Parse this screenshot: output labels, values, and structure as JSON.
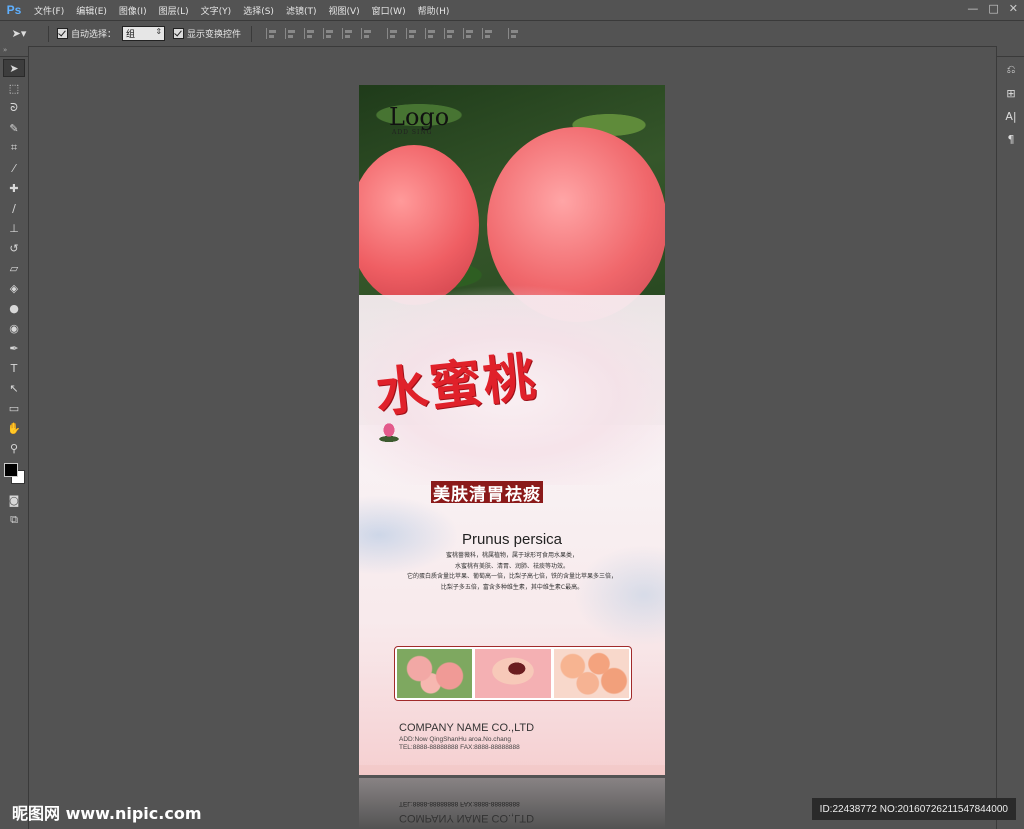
{
  "app": {
    "logo": "Ps"
  },
  "menu": [
    "文件(F)",
    "编辑(E)",
    "图像(I)",
    "图层(L)",
    "文字(Y)",
    "选择(S)",
    "滤镜(T)",
    "视图(V)",
    "窗口(W)",
    "帮助(H)"
  ],
  "window_controls": {
    "minimize": "—",
    "restore": "□",
    "close": "✕"
  },
  "options": {
    "auto_select_label": "自动选择：",
    "auto_select_value": "组",
    "show_transform_label": "显示变换控件"
  },
  "tools": [
    "move-tool",
    "marquee-tool",
    "lasso-tool",
    "quick-select-tool",
    "crop-tool",
    "eyedropper-tool",
    "healing-brush-tool",
    "brush-tool",
    "clone-stamp-tool",
    "history-brush-tool",
    "eraser-tool",
    "paint-bucket-tool",
    "blur-tool",
    "dodge-tool",
    "pen-tool",
    "type-tool",
    "path-select-tool",
    "shape-tool",
    "hand-tool",
    "zoom-tool"
  ],
  "poster": {
    "logo": "Logo",
    "logo_sub": "ADD SING",
    "title_cn": "水蜜桃",
    "slogan": "美肤清胃祛痰",
    "latin": "Prunus persica",
    "description": [
      "蜜桃蔷薇科，桃属植物，属于球形可食用水果类，",
      "水蜜桃有美肤、清胃、润肺、祛痰等功效。",
      "它的蛋白质含量比苹果、葡萄高一倍，比梨子高七倍，铁的含量比苹果多三倍，",
      "比梨子多五倍，富含多种维生素，其中维生素C最高。"
    ],
    "company": "COMPANY NAME CO.,LTD",
    "address": "ADD:Now QingShanHu aroa.No.chang",
    "tel": "TEL:8888-88888888   FAX:8888-88888888"
  },
  "watermark": {
    "site": "昵图网 www.nipic.com",
    "id": "ID:22438772 NO:20160726211547844000"
  }
}
